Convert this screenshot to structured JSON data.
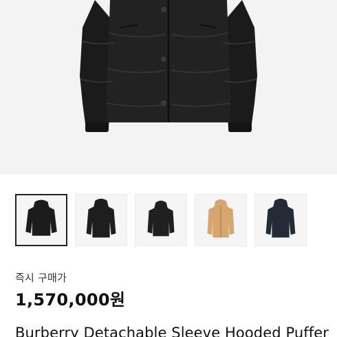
{
  "product": {
    "buy_label": "즉시 구매가",
    "price": "1,570,000원",
    "title": "Burberry Detachable Sleeve Hooded Puffer"
  },
  "gallery": {
    "main_image_icon": "black-puffer-jacket-image",
    "thumbnails": [
      {
        "icon": "black-puffer-jacket-thumbnail",
        "color": "#1c1c1c",
        "selected": true
      },
      {
        "icon": "black-puffer-jacket-thumbnail",
        "color": "#1e1e1e",
        "selected": false
      },
      {
        "icon": "black-puffer-jacket-thumbnail",
        "color": "#202020",
        "selected": false
      },
      {
        "icon": "tan-puffer-jacket-thumbnail",
        "color": "#d7a66e",
        "selected": false
      },
      {
        "icon": "navy-puffer-jacket-thumbnail",
        "color": "#242a36",
        "selected": false
      }
    ]
  },
  "colors": {
    "hero_background": "#f3f3f3",
    "jacket_black": "#1a1a1a",
    "selected_border": "#222222"
  }
}
